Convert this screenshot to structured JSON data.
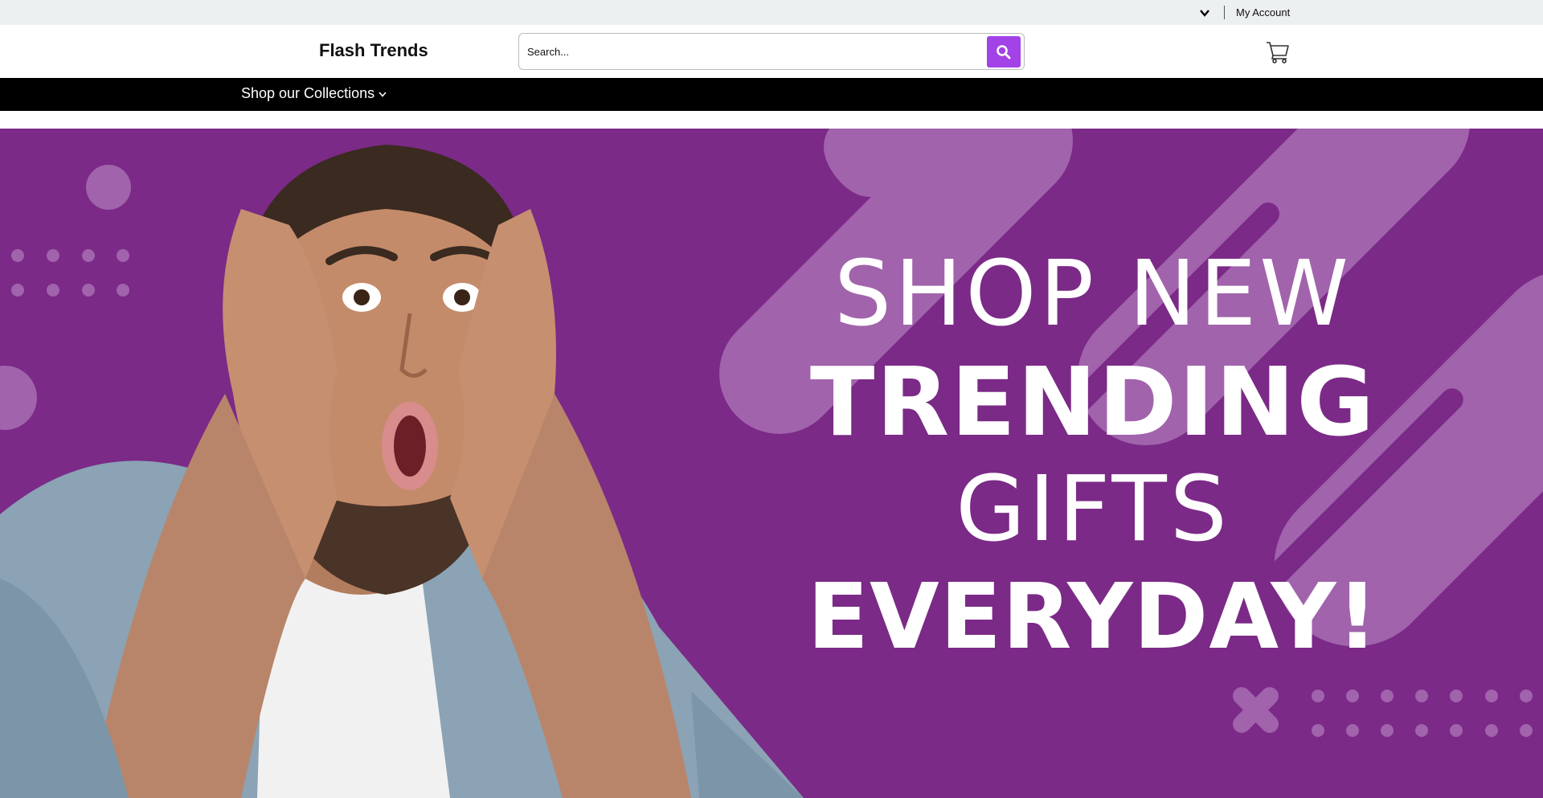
{
  "topbar": {
    "account_label": "My Account",
    "dropdown_icon": "chevron-down-icon"
  },
  "header": {
    "logo": "Flash Trends",
    "search": {
      "placeholder": "Search...",
      "button_icon": "search-icon"
    },
    "cart_icon": "shopping-cart-icon"
  },
  "nav": {
    "collections_label": "Shop our Collections",
    "collections_icon": "chevron-down-icon"
  },
  "hero": {
    "line1": "SHOP NEW",
    "line2": "TRENDING",
    "line3": "GIFTS",
    "line4": "EVERYDAY!",
    "background_color": "#7b2a87",
    "image": "surprised-man-photo"
  },
  "colors": {
    "accent": "#a342e6",
    "navbar": "#000000",
    "topbar": "#ecf0f1"
  }
}
